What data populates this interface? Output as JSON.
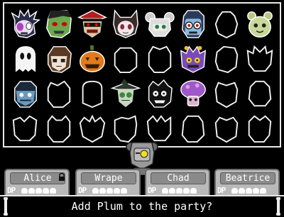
{
  "grid_rows": [
    [
      "spiky-purple-kid",
      "green-zombie",
      "red-hat-vampire",
      "cat-eared-girl",
      "twin-bun-girl",
      "blue-glasses-kid",
      "locked",
      "green-bear"
    ],
    [
      "white-ghost",
      "brown-hair-kid",
      "jack-o-lantern",
      "locked",
      "locked",
      "purple-monster",
      "locked",
      "locked"
    ],
    [
      "blue-zombie",
      "locked",
      "locked",
      "green-witch",
      "black-shadow",
      "purple-mushroom",
      "locked",
      "locked"
    ],
    [
      "locked",
      "locked",
      "locked",
      "locked",
      "locked",
      "locked",
      "locked",
      "locked"
    ]
  ],
  "party": [
    {
      "name": "Alice",
      "dp_label": "DP",
      "locked": true
    },
    {
      "name": "Wrape",
      "dp_label": "DP",
      "locked": false
    },
    {
      "name": "Chad",
      "dp_label": "DP",
      "locked": false
    },
    {
      "name": "Beatrice",
      "dp_label": "DP",
      "locked": false
    }
  ],
  "prompt_text": "Add Plum to the party?",
  "current_character": "plum-robot",
  "colors": {
    "frame": "#e8e8e8",
    "tab": "#b9b9b9",
    "name_box": "#8a8a8a"
  }
}
